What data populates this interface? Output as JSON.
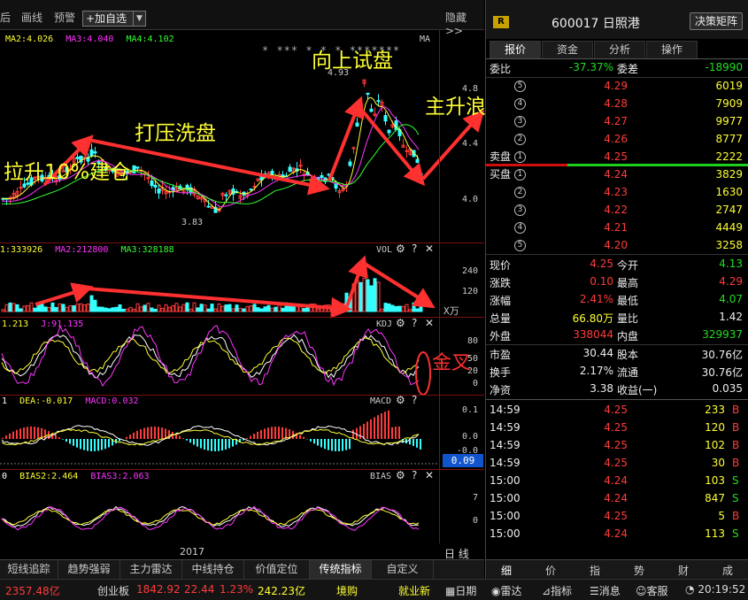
{
  "toolbar": {
    "items": [
      "画线",
      "预警"
    ],
    "partial_left": "后",
    "add_fav": "+加自选",
    "add_fav_drop": "▼",
    "hide": "隐藏>>"
  },
  "main_pane": {
    "legend": [
      {
        "text": "MA2:4.026",
        "color": "#ffff33"
      },
      {
        "text": "MA3:4.040",
        "color": "#ff33ff"
      },
      {
        "text": "MA4:4.102",
        "color": "#33ff33"
      }
    ],
    "title": "MA",
    "axis_labels": [
      "4.8",
      "4.4",
      "4.0"
    ],
    "high_label": "4.93",
    "low_label": "3.83",
    "stars": "* *** * * * *******",
    "annotations": {
      "a1": "拉升10%建仓",
      "a2": "打压洗盘",
      "a3": "向上试盘",
      "a4": "主升浪"
    }
  },
  "vol_pane": {
    "legend": [
      {
        "text": "1:333926",
        "color": "#ffff33"
      },
      {
        "text": "MA2:212800",
        "color": "#ff33ff"
      },
      {
        "text": "MA3:328188",
        "color": "#33ff33"
      }
    ],
    "title": "VOL",
    "axis_labels": [
      "240",
      "120"
    ],
    "unit": "X万"
  },
  "kdj_pane": {
    "legend": [
      {
        "text": "1.213",
        "color": "#ffff33"
      },
      {
        "text": "J:91.135",
        "color": "#ff33ff"
      }
    ],
    "title": "KDJ",
    "axis_labels": [
      "80",
      "50",
      "20",
      "0"
    ],
    "annotation": "金叉"
  },
  "macd_pane": {
    "legend": [
      {
        "text": "1",
        "color": "#ffffff"
      },
      {
        "text": "DEA:-0.017",
        "color": "#ffff33"
      },
      {
        "text": "MACD:0.032",
        "color": "#ff33ff"
      }
    ],
    "title": "MACD",
    "axis_labels": [
      "0.1",
      "0.0",
      "-0.0"
    ],
    "current": "0.09"
  },
  "bias_pane": {
    "legend": [
      {
        "text": "0",
        "color": "#ffffff"
      },
      {
        "text": "BIAS2:2.464",
        "color": "#ffff33"
      },
      {
        "text": "BIAS3:2.063",
        "color": "#ff33ff"
      }
    ],
    "title": "BIAS",
    "axis_labels": [
      "7",
      "0"
    ]
  },
  "pane_controls": {
    "gear": "⚙",
    "help": "?",
    "close": "✕"
  },
  "year": "2017",
  "period": "日 线",
  "bottom_tabs": [
    "短线追踪",
    "趋势强弱",
    "主力雷达",
    "中线持仓",
    "价值定位",
    "传统指标",
    "自定义"
  ],
  "status": {
    "index1_val": "2357.48亿",
    "index2_name": "创业板",
    "index2_points": "1842.92",
    "index2_change": "22.44",
    "index2_pct": "1.23%",
    "index2_amount": "242.23亿",
    "buy_label": "境购",
    "news": "就业新",
    "buttons": [
      "日期",
      "雷达",
      "指标",
      "消息",
      "客服"
    ],
    "time": "20:19:52"
  },
  "quote": {
    "badge": "R",
    "code": "600017",
    "name": "日照港",
    "matrix_btn": "决策矩阵",
    "tabs": [
      "报价",
      "资金",
      "分析",
      "操作"
    ],
    "weibi_label": "委比",
    "weibi": "-37.37%",
    "weicha_label": "委差",
    "weicha": "-18990",
    "sell_label": "卖盘",
    "buy_label": "买盘",
    "asks": [
      {
        "lvl": "5",
        "price": "4.29",
        "vol": "6019"
      },
      {
        "lvl": "4",
        "price": "4.28",
        "vol": "7909"
      },
      {
        "lvl": "3",
        "price": "4.27",
        "vol": "9977"
      },
      {
        "lvl": "2",
        "price": "4.26",
        "vol": "8777"
      },
      {
        "lvl": "1",
        "price": "4.25",
        "vol": "2222"
      }
    ],
    "bids": [
      {
        "lvl": "1",
        "price": "4.24",
        "vol": "3829"
      },
      {
        "lvl": "2",
        "price": "4.23",
        "vol": "1630"
      },
      {
        "lvl": "3",
        "price": "4.22",
        "vol": "2747"
      },
      {
        "lvl": "4",
        "price": "4.21",
        "vol": "4449"
      },
      {
        "lvl": "5",
        "price": "4.20",
        "vol": "3258"
      }
    ],
    "stats": [
      {
        "l1": "现价",
        "v1": "4.25",
        "c1": "red",
        "l2": "今开",
        "v2": "4.13",
        "c2": "green"
      },
      {
        "l1": "涨跌",
        "v1": "0.10",
        "c1": "red",
        "l2": "最高",
        "v2": "4.29",
        "c2": "red"
      },
      {
        "l1": "涨幅",
        "v1": "2.41%",
        "c1": "red",
        "l2": "最低",
        "v2": "4.07",
        "c2": "green"
      },
      {
        "l1": "总量",
        "v1": "66.80万",
        "c1": "yellow",
        "l2": "量比",
        "v2": "1.42",
        "c2": "white"
      },
      {
        "l1": "外盘",
        "v1": "338044",
        "c1": "red",
        "l2": "内盘",
        "v2": "329937",
        "c2": "green"
      }
    ],
    "stats2": [
      {
        "l1": "市盈",
        "v1": "30.44",
        "l2": "股本",
        "v2": "30.76亿"
      },
      {
        "l1": "换手",
        "v1": "2.17%",
        "l2": "流通",
        "v2": "30.76亿"
      },
      {
        "l1": "净资",
        "v1": "3.38",
        "l2": "收益(一)",
        "v2": "0.035"
      }
    ],
    "ticks": [
      {
        "t": "14:59",
        "p": "4.25",
        "pc": "red",
        "v": "233",
        "d": "B"
      },
      {
        "t": "14:59",
        "p": "4.25",
        "pc": "red",
        "v": "120",
        "d": "B"
      },
      {
        "t": "14:59",
        "p": "4.25",
        "pc": "red",
        "v": "102",
        "d": "B"
      },
      {
        "t": "14:59",
        "p": "4.25",
        "pc": "red",
        "v": "30",
        "d": "B"
      },
      {
        "t": "15:00",
        "p": "4.24",
        "pc": "red",
        "v": "103",
        "d": "S"
      },
      {
        "t": "15:00",
        "p": "4.24",
        "pc": "red",
        "v": "847",
        "d": "S"
      },
      {
        "t": "15:00",
        "p": "4.25",
        "pc": "red",
        "v": "5",
        "d": "B"
      },
      {
        "t": "15:00",
        "p": "4.24",
        "pc": "red",
        "v": "113",
        "d": "S"
      }
    ],
    "bottom_tabs": [
      "细",
      "价",
      "指",
      "势",
      "财",
      "成"
    ]
  }
}
